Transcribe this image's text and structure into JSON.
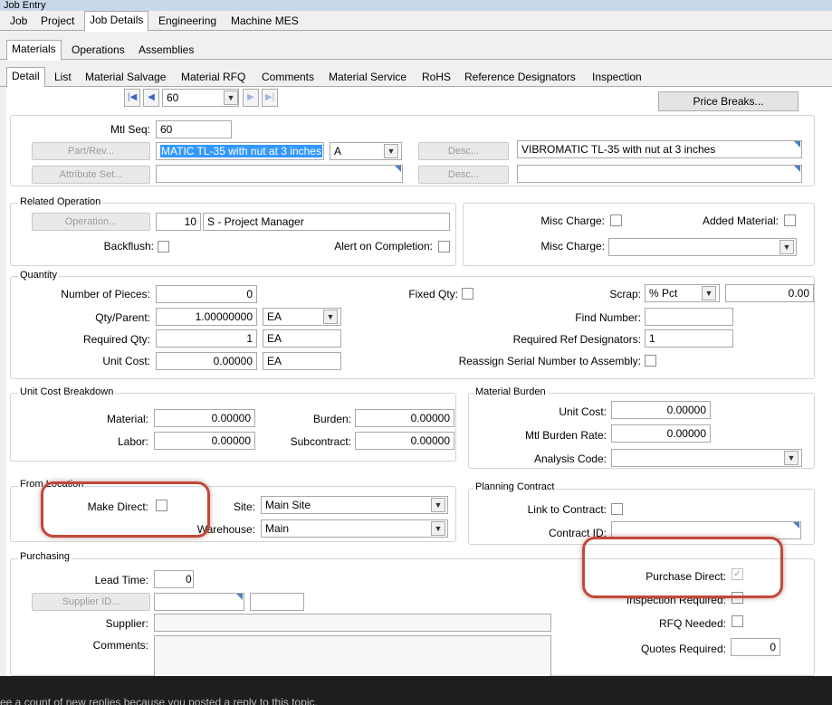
{
  "window": {
    "title": "Job Entry"
  },
  "tabs_main": [
    "Job",
    "Project",
    "Job Details",
    "Engineering",
    "Machine MES"
  ],
  "tabs_sub": [
    "Materials",
    "Operations",
    "Assemblies"
  ],
  "tabs_detail": [
    "Detail",
    "List",
    "Material Salvage",
    "Material RFQ",
    "Comments",
    "Material Service",
    "RoHS",
    "Reference Designators",
    "Inspection"
  ],
  "nav": {
    "current": "60",
    "first": "|◀",
    "prev": "◀",
    "next": "▶",
    "last": "▶|"
  },
  "price_breaks": "Price Breaks...",
  "header": {
    "mtl_seq_label": "Mtl Seq:",
    "mtl_seq": "60",
    "part_rev_btn": "Part/Rev...",
    "part_value": "MATIC TL-35 with nut at 3 inches",
    "rev_value": "A",
    "desc_btn": "Desc...",
    "desc_value": "VIBROMATIC TL-35 with nut at 3 inches",
    "attr_set_btn": "Attribute Set...",
    "desc_btn2": "Desc..."
  },
  "related_operation": {
    "title": "Related Operation",
    "operation_btn": "Operation...",
    "op_seq": "10",
    "op_desc": "S - Project Manager",
    "backflush_label": "Backflush:",
    "alert_label": "Alert on Completion:",
    "misc_charge_label": "Misc Charge:",
    "added_material_label": "Added Material:",
    "misc_charge2_label": "Misc Charge:"
  },
  "quantity": {
    "title": "Quantity",
    "num_pieces_label": "Number of Pieces:",
    "num_pieces": "0",
    "qty_parent_label": "Qty/Parent:",
    "qty_parent": "1.00000000",
    "qty_parent_uom": "EA",
    "required_qty_label": "Required Qty:",
    "required_qty": "1",
    "required_qty_uom": "EA",
    "unit_cost_label": "Unit Cost:",
    "unit_cost": "0.00000",
    "unit_cost_uom": "EA",
    "fixed_qty_label": "Fixed Qty:",
    "scrap_label": "Scrap:",
    "scrap_type": "% Pct",
    "scrap_value": "0.00",
    "find_number_label": "Find Number:",
    "req_ref_label": "Required Ref Designators:",
    "req_ref_value": "1",
    "reassign_label": "Reassign Serial Number to Assembly:"
  },
  "unit_cost_breakdown": {
    "title": "Unit Cost Breakdown",
    "material_label": "Material:",
    "material": "0.00000",
    "labor_label": "Labor:",
    "labor": "0.00000",
    "burden_label": "Burden:",
    "burden": "0.00000",
    "subcontract_label": "Subcontract:",
    "subcontract": "0.00000"
  },
  "material_burden": {
    "title": "Material Burden",
    "unit_cost_label": "Unit Cost:",
    "unit_cost": "0.00000",
    "rate_label": "Mtl Burden Rate:",
    "rate": "0.00000",
    "analysis_label": "Analysis Code:"
  },
  "from_location": {
    "title": "From Location",
    "make_direct_label": "Make Direct:",
    "site_label": "Site:",
    "site": "Main Site",
    "warehouse_label": "Warehouse:",
    "warehouse": "Main"
  },
  "planning_contract": {
    "title": "Planning Contract",
    "link_label": "Link to Contract:",
    "contract_id_label": "Contract ID:"
  },
  "purchasing": {
    "title": "Purchasing",
    "lead_time_label": "Lead Time:",
    "lead_time": "0",
    "supplier_id_btn": "Supplier ID...",
    "supplier_label": "Supplier:",
    "comments_label": "Comments:",
    "purchase_direct_label": "Purchase Direct:",
    "inspection_label": "Inspection Required:",
    "rfq_label": "RFQ Needed:",
    "quotes_label": "Quotes Required:",
    "quotes": "0"
  },
  "footer_text": "ee a count of new replies because you posted a reply to this topic.",
  "colors": {
    "highlight": "#c2483a",
    "selection": "#3399ff"
  }
}
